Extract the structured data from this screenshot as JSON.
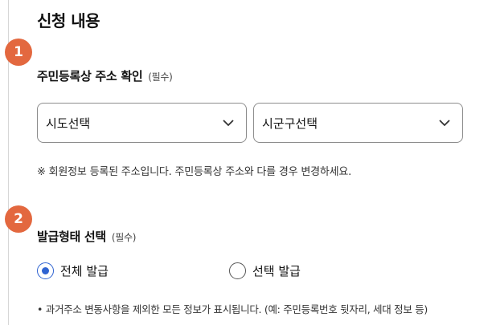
{
  "page": {
    "title": "신청 내용"
  },
  "steps": [
    "1",
    "2"
  ],
  "address": {
    "label": "주민등록상 주소 확인",
    "required": "(필수)",
    "sido_select": "시도선택",
    "sigungu_select": "시군구선택",
    "notice": "※ 회원정보 등록된 주소입니다. 주민등록상 주소와 다를 경우 변경하세요."
  },
  "issue_type": {
    "label": "발급형태 선택",
    "required": "(필수)",
    "options": [
      "전체 발급",
      "선택 발급"
    ],
    "selected": "전체 발급",
    "footnote": "• 과거주소 변동사항을 제외한 모든 정보가 표시됩니다. (예: 주민등록번호 뒷자리, 세대 정보 등)"
  },
  "colors": {
    "step_badge": "#e3683f",
    "radio_accent": "#2f63d1"
  }
}
